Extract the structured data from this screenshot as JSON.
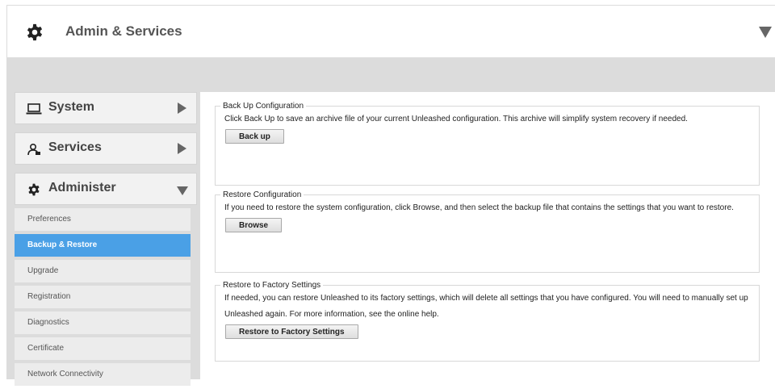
{
  "header": {
    "title": "Admin & Services"
  },
  "sidebar": {
    "groups": [
      {
        "label": "System",
        "icon": "laptop-icon",
        "expanded": false
      },
      {
        "label": "Services",
        "icon": "services-icon",
        "expanded": false
      },
      {
        "label": "Administer",
        "icon": "gear-icon",
        "expanded": true
      }
    ],
    "items": [
      {
        "label": "Preferences",
        "active": false
      },
      {
        "label": "Backup & Restore",
        "active": true
      },
      {
        "label": "Upgrade",
        "active": false
      },
      {
        "label": "Registration",
        "active": false
      },
      {
        "label": "Diagnostics",
        "active": false
      },
      {
        "label": "Certificate",
        "active": false
      },
      {
        "label": "Network Connectivity",
        "active": false
      }
    ]
  },
  "main": {
    "backup": {
      "legend": "Back Up Configuration",
      "description": "Click Back Up to save an archive file of your current Unleashed configuration. This archive will simplify system recovery if needed.",
      "button": "Back up"
    },
    "restore": {
      "legend": "Restore Configuration",
      "description": "If you need to restore the system configuration, click Browse, and then select the backup file that contains the settings that you want to restore.",
      "button": "Browse"
    },
    "factory": {
      "legend": "Restore to Factory Settings",
      "description": "If needed, you can restore Unleashed to its factory settings, which will delete all settings that you have configured. You will need to manually set up Unleashed again. For more information, see the online help.",
      "button": "Restore to Factory Settings"
    }
  },
  "colors": {
    "accent": "#4aa0e6",
    "band": "#dcdcdc"
  }
}
